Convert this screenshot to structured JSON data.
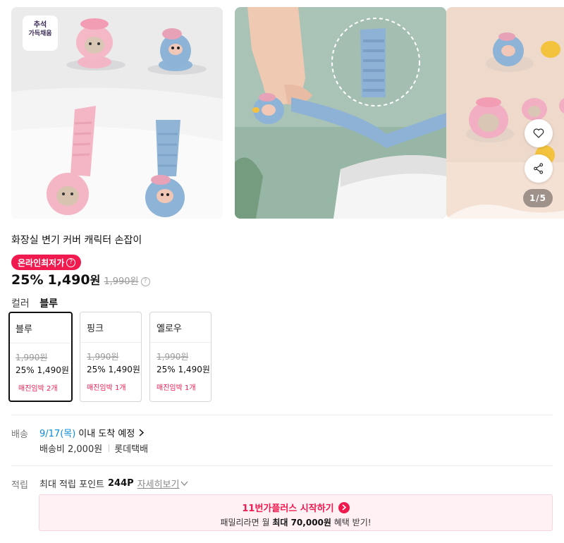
{
  "gallery": {
    "promo_sticker_line1": "추석",
    "promo_sticker_line2": "가득채움",
    "counter": "1/5",
    "like_icon": "heart-icon",
    "share_icon": "share-icon"
  },
  "product": {
    "title": "화장실 변기 커버 캐릭터 손잡이",
    "badge": "온라인최저가",
    "discount": "25%",
    "price": "1,490",
    "won": "원",
    "original_price": "1,990원"
  },
  "color": {
    "label": "컬러",
    "selected": "블루"
  },
  "options": [
    {
      "name": "블루",
      "original": "1,990원",
      "price": "25% 1,490원",
      "stock": "매진임박 2개",
      "selected": true
    },
    {
      "name": "핑크",
      "original": "1,990원",
      "price": "25% 1,490원",
      "stock": "매진임박 1개",
      "selected": false
    },
    {
      "name": "옐로우",
      "original": "1,990원",
      "price": "25% 1,490원",
      "stock": "매진임박 1개",
      "selected": false
    }
  ],
  "delivery": {
    "label": "배송",
    "date": "9/17(목)",
    "date_suffix": "이내 도착 예정",
    "fee": "배송비 2,000원",
    "carrier": "롯데택배"
  },
  "points": {
    "label": "적립",
    "text": "최대 적립 포인트",
    "amount": "244P",
    "more": "자세히보기"
  },
  "plus": {
    "head": "11번가플러스 시작하기",
    "sub_pre": "패밀리라면 월",
    "sub_bold": "최대 70,000원",
    "sub_post": "혜택 받기!"
  },
  "colors": {
    "accent": "#f01a4f",
    "link_blue": "#0a8bd8"
  }
}
